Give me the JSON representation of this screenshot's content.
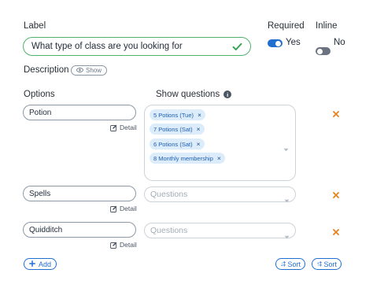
{
  "field": {
    "label_heading": "Label",
    "label_value": "What type of class are you looking for",
    "required_heading": "Required",
    "required_toggle": "on",
    "required_text": "Yes",
    "inline_heading": "Inline",
    "inline_toggle": "off",
    "inline_text": "No",
    "description_heading": "Description",
    "description_show": "Show"
  },
  "columns": {
    "options": "Options",
    "show_questions": "Show questions"
  },
  "options": [
    {
      "value": "Potion",
      "detail": "Detail",
      "questions": [
        "5 Potions (Tue)",
        "7 Potions (Sat)",
        "6 Potions (Sat)",
        "8 Monthly membership"
      ]
    },
    {
      "value": "Spells",
      "detail": "Detail",
      "placeholder": "Questions"
    },
    {
      "value": "Quidditch",
      "detail": "Detail",
      "placeholder": "Questions"
    }
  ],
  "footer": {
    "add": "Add",
    "sort_desc": "Sort",
    "sort_asc": "Sort"
  },
  "colors": {
    "accent": "#1f6fd1",
    "valid": "#4fb36c",
    "remove": "#e8821e",
    "chip_bg": "#dcecfa"
  },
  "icons": [
    "check-icon",
    "eye-icon",
    "info-icon",
    "edit-icon",
    "close-icon",
    "chevron-down-icon",
    "plus-icon",
    "sort-icon"
  ]
}
